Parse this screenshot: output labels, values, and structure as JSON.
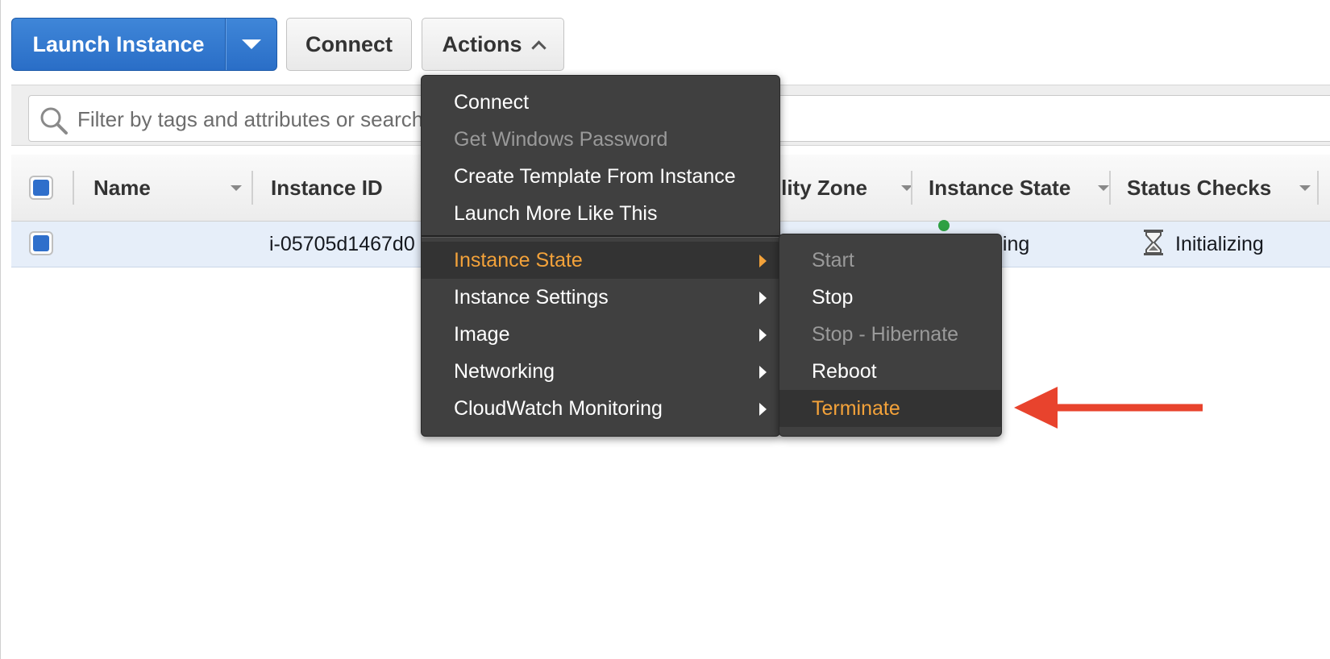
{
  "toolbar": {
    "launch_label": "Launch Instance",
    "connect_label": "Connect",
    "actions_label": "Actions"
  },
  "filter": {
    "placeholder": "Filter by tags and attributes or search by keyword"
  },
  "table": {
    "columns": [
      "Name",
      "Instance ID",
      "Availability Zone",
      "Instance State",
      "Status Checks"
    ],
    "visible_column_labels": {
      "name": "Name",
      "instance_id": "Instance ID",
      "availability_zone_partial": "bility Zone",
      "instance_state": "Instance State",
      "status_checks": "Status Checks"
    },
    "rows": [
      {
        "name": "",
        "instance_id_visible": "i-05705d1467d0",
        "instance_state_visible": "ning",
        "status_checks": "Initializing"
      }
    ]
  },
  "actions_menu": {
    "items": [
      {
        "label": "Connect",
        "disabled": false
      },
      {
        "label": "Get Windows Password",
        "disabled": true
      },
      {
        "label": "Create Template From Instance",
        "disabled": false
      },
      {
        "label": "Launch More Like This",
        "disabled": false
      },
      {
        "label": "Instance State",
        "active": true,
        "submenu": true
      },
      {
        "label": "Instance Settings",
        "submenu": true
      },
      {
        "label": "Image",
        "submenu": true
      },
      {
        "label": "Networking",
        "submenu": true
      },
      {
        "label": "CloudWatch Monitoring",
        "submenu": true
      }
    ]
  },
  "instance_state_menu": {
    "items": [
      {
        "label": "Start",
        "disabled": true
      },
      {
        "label": "Stop",
        "disabled": false
      },
      {
        "label": "Stop - Hibernate",
        "disabled": true
      },
      {
        "label": "Reboot",
        "disabled": false
      },
      {
        "label": "Terminate",
        "active": true
      }
    ]
  },
  "colors": {
    "primary_button": "#2a6ec7",
    "menu_background": "#404040",
    "menu_highlight_text": "#f3a23a",
    "annotation_arrow": "#e8432d",
    "row_selected": "#e6eef9"
  },
  "icons": {
    "search": "search-icon",
    "hourglass": "hourglass-icon",
    "submenu": "chevron-right-icon"
  }
}
